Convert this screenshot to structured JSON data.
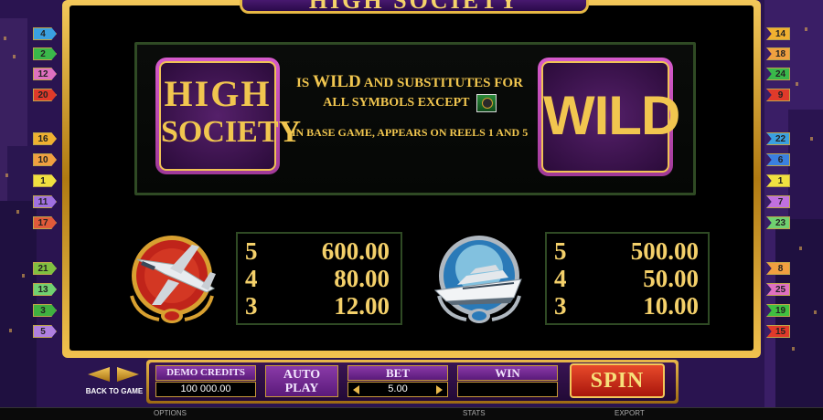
{
  "title": "HIGH SOCIETY",
  "wild_info": {
    "logo_line1": "HIGH",
    "logo_line2": "SOCIETY",
    "text_prefix": "IS",
    "text_wild": "WILD",
    "text_rest": "AND SUBSTITUTES FOR",
    "text_line2": "ALL SYMBOLS EXCEPT",
    "text_line3": "IN BASE GAME, APPEARS ON REELS 1 AND 5",
    "wild_label": "WILD"
  },
  "paytable": [
    {
      "symbol": "jet",
      "rows": [
        {
          "count": "5",
          "value": "600.00"
        },
        {
          "count": "4",
          "value": "80.00"
        },
        {
          "count": "3",
          "value": "12.00"
        }
      ]
    },
    {
      "symbol": "yacht",
      "rows": [
        {
          "count": "5",
          "value": "500.00"
        },
        {
          "count": "4",
          "value": "50.00"
        },
        {
          "count": "3",
          "value": "10.00"
        }
      ]
    }
  ],
  "paylines_left": [
    {
      "n": "4",
      "color": "#3aa0e0"
    },
    {
      "n": "2",
      "color": "#3ab84a"
    },
    {
      "n": "12",
      "color": "#e070c0"
    },
    {
      "n": "20",
      "color": "#e03a2a"
    },
    {
      "n": "16",
      "color": "#f0b030"
    },
    {
      "n": "10",
      "color": "#f0a040"
    },
    {
      "n": "1",
      "color": "#f0e040"
    },
    {
      "n": "11",
      "color": "#a070e0"
    },
    {
      "n": "17",
      "color": "#e05a3a"
    },
    {
      "n": "21",
      "color": "#80c040"
    },
    {
      "n": "13",
      "color": "#70d070"
    },
    {
      "n": "3",
      "color": "#40b040"
    },
    {
      "n": "5",
      "color": "#b080e0"
    }
  ],
  "paylines_right": [
    {
      "n": "14",
      "color": "#f0b030"
    },
    {
      "n": "18",
      "color": "#f0a040"
    },
    {
      "n": "24",
      "color": "#3ab84a"
    },
    {
      "n": "9",
      "color": "#e03a2a"
    },
    {
      "n": "22",
      "color": "#3aa0e0"
    },
    {
      "n": "6",
      "color": "#3a80e0"
    },
    {
      "n": "1",
      "color": "#f0e040"
    },
    {
      "n": "7",
      "color": "#c070e0"
    },
    {
      "n": "23",
      "color": "#70d070"
    },
    {
      "n": "8",
      "color": "#f0a040"
    },
    {
      "n": "25",
      "color": "#e070c0"
    },
    {
      "n": "19",
      "color": "#40c040"
    },
    {
      "n": "15",
      "color": "#e03a2a"
    }
  ],
  "controls": {
    "back_label": "BACK TO GAME",
    "credits_label": "DEMO CREDITS",
    "credits_value": "100 000.00",
    "autoplay_line1": "AUTO",
    "autoplay_line2": "PLAY",
    "bet_label": "BET",
    "bet_value": "5.00",
    "win_label": "WIN",
    "win_value": "",
    "spin_label": "SPIN"
  },
  "status_bar": {
    "options": "OPTIONS",
    "stats": "STATS",
    "export": "EXPORT"
  },
  "colors": {
    "gold": "#f1c64f",
    "purple": "#5a1a7a",
    "spin_red": "#c8201a"
  }
}
